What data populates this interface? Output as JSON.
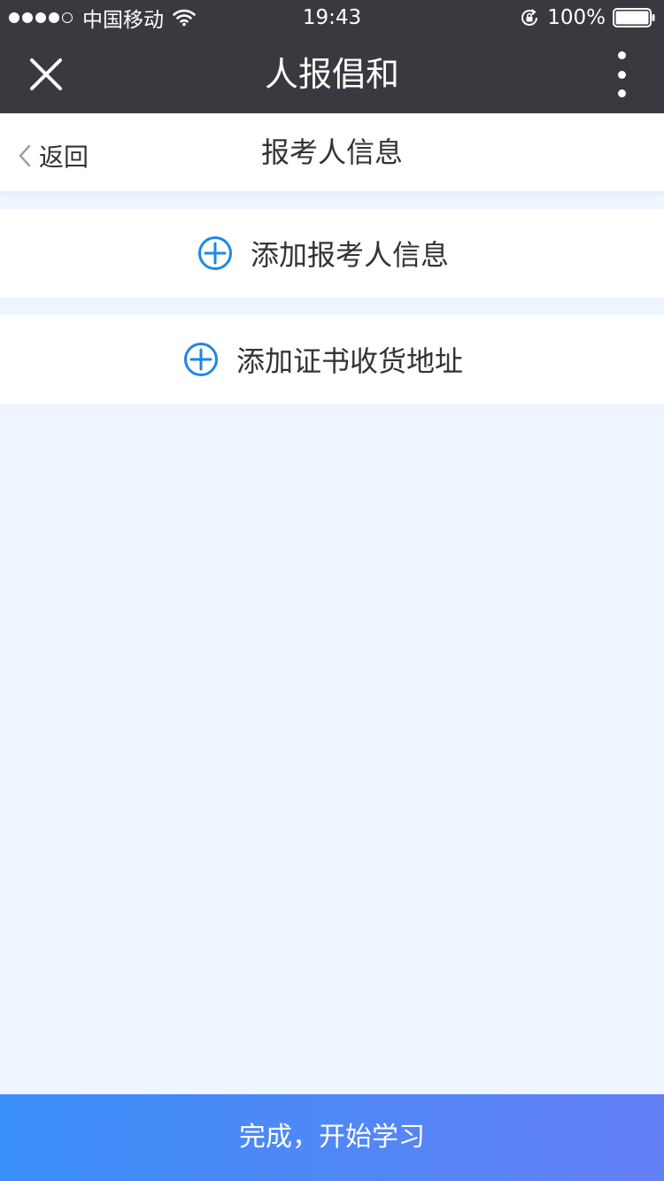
{
  "status_bar": {
    "carrier": "中国移动",
    "time": "19:43",
    "battery": "100%",
    "signal_filled": 4,
    "signal_total": 5,
    "icons": [
      "signal-icon",
      "wifi-icon",
      "rotation-lock-icon",
      "battery-icon"
    ]
  },
  "nav_bar": {
    "title": "人报倡和",
    "close_icon": "close-icon",
    "more_icon": "more-vertical-icon"
  },
  "sub_header": {
    "back_label": "返回",
    "title": "报考人信息",
    "back_icon": "chevron-left-icon"
  },
  "actions": {
    "add_applicant_label": "添加报考人信息",
    "add_address_label": "添加证书收货地址",
    "icon": "plus-circle-icon"
  },
  "footer": {
    "finish_label": "完成，开始学习"
  },
  "colors": {
    "top_bar": "#393a3f",
    "background": "#eef5fe",
    "accent": "#1e87e6",
    "button_gradient_start": "#3a8ff8",
    "button_gradient_end": "#6580f6"
  }
}
